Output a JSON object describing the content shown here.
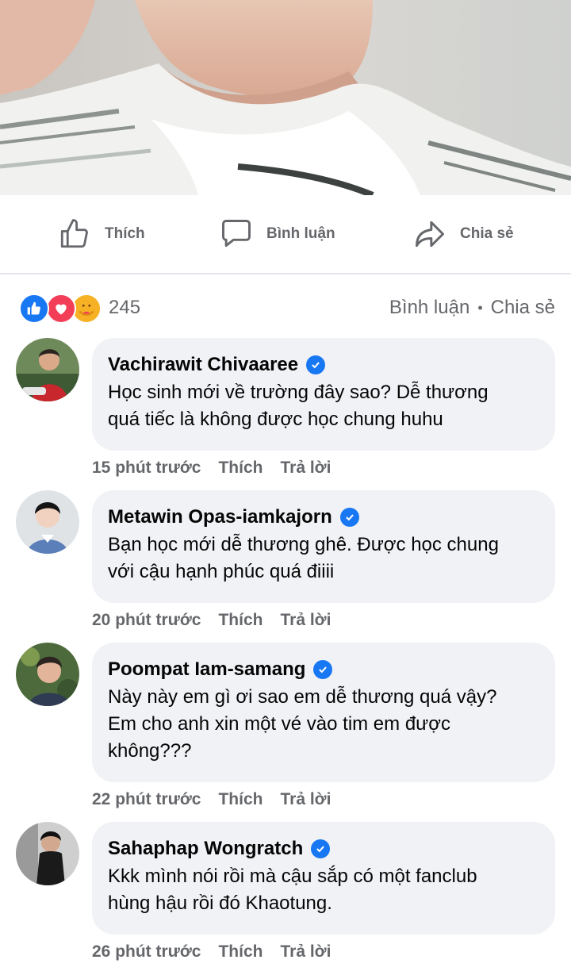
{
  "post_actions": {
    "like_label": "Thích",
    "comment_label": "Bình luận",
    "share_label": "Chia sẻ"
  },
  "stats": {
    "reactions": [
      "like",
      "love",
      "care"
    ],
    "reaction_count": "245",
    "comments_link": "Bình luận",
    "separator": "•",
    "shares_link": "Chia sẻ"
  },
  "comments": [
    {
      "author": "Vachirawit Chivaaree",
      "verified": true,
      "text_line1": "Học sinh mới về trường đây sao? Dễ thương",
      "text_line2": "quá tiếc là không được học chung huhu",
      "text_line3": "",
      "time": "15 phút trước",
      "like": "Thích",
      "reply": "Trả lời"
    },
    {
      "author": "Metawin Opas-iamkajorn",
      "verified": true,
      "text_line1": "Bạn học mới dễ thương ghê. Được học chung",
      "text_line2": "với cậu hạnh phúc quá điiii",
      "text_line3": "",
      "time": "20 phút trước",
      "like": "Thích",
      "reply": "Trả lời"
    },
    {
      "author": "Poompat Iam-samang",
      "verified": true,
      "text_line1": "Này này em gì ơi sao em dễ thương quá vậy?",
      "text_line2": "Em cho anh xin một vé vào tim em được",
      "text_line3": "không???",
      "time": "22 phút trước",
      "like": "Thích",
      "reply": "Trả lời"
    },
    {
      "author": "Sahaphap Wongratch",
      "verified": true,
      "text_line1": "Kkk mình nói rồi mà cậu sắp có một fanclub",
      "text_line2": "hùng hậu rồi đó Khaotung.",
      "text_line3": "",
      "time": "26 phút trước",
      "like": "Thích",
      "reply": "Trả lời"
    }
  ],
  "colors": {
    "accent": "#1877f2",
    "muted_text": "#65676b",
    "bubble_bg": "#f0f2f5"
  }
}
